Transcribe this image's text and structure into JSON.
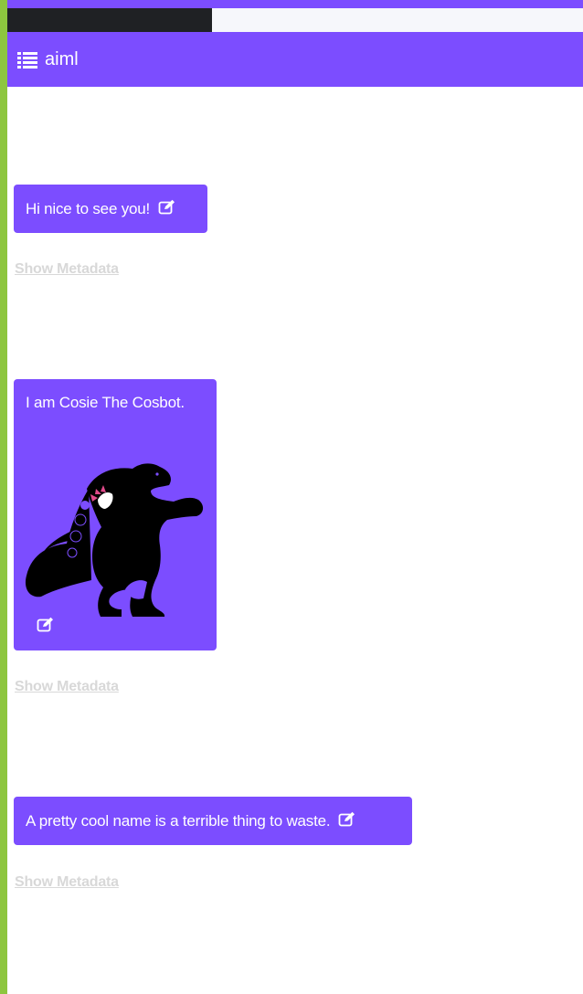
{
  "app": {
    "accent_color": "#7c4dff",
    "sidebar_strip_color": "#8dc63f"
  },
  "header": {
    "icon": "list-icon",
    "title": "aiml"
  },
  "messages": [
    {
      "text": "Hi nice to see you!",
      "edit_icon": "edit-icon",
      "metadata_link": "Show Metadata"
    },
    {
      "text": "I am Cosie The Cosbot.",
      "image": "dinosaur-image",
      "edit_icon": "edit-icon",
      "metadata_link": "Show Metadata"
    },
    {
      "text": "A pretty cool name is a terrible thing to waste.",
      "edit_icon": "edit-icon",
      "metadata_link": "Show Metadata"
    }
  ]
}
